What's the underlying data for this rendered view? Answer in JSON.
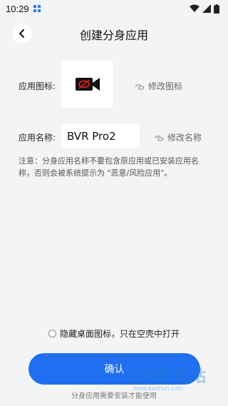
{
  "status_bar": {
    "time": "10:29",
    "icons": [
      "notification-icon",
      "wifi-icon",
      "signal-icon",
      "battery-icon"
    ]
  },
  "header": {
    "title": "创建分身应用",
    "back_icon": "back-arrow-icon"
  },
  "app_icon_row": {
    "label": "应用图标:",
    "icon": "video-camera-icon",
    "edit_label": "修改图标"
  },
  "app_name_row": {
    "label": "应用名称:",
    "value": "BVR Pro2",
    "edit_label": "修改名称"
  },
  "note": "注意：分身应用名称不要包含原应用或已安装应用名称，否则会被系统提示为 \"恶意/风险应用\"。",
  "hide_option": {
    "label": "隐藏桌面图标，只在空壳中打开",
    "checked": false
  },
  "confirm_button": {
    "label": "确认"
  },
  "footnote": "分身应用需要安装才能使用",
  "watermark": {
    "text": "卡准软件站",
    "url": "www.kazhun.com"
  },
  "colors": {
    "background": "#f3f4f6",
    "accent": "#1f6ff0",
    "icon_red": "#d11a1a"
  }
}
